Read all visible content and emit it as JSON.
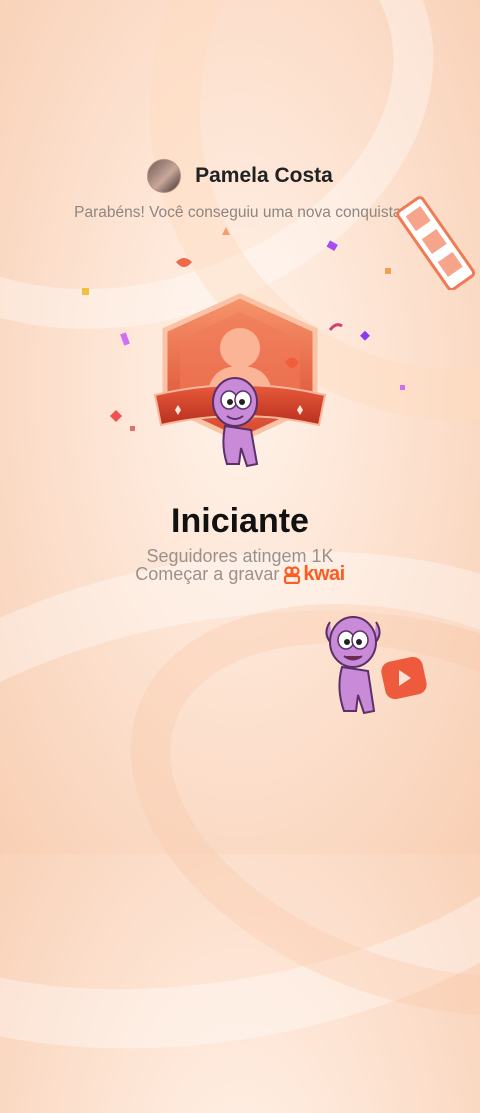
{
  "user": {
    "name": "Pamela Costa"
  },
  "message": "Parabéns! Você conseguiu uma nova conquista!",
  "achievement": {
    "title": "Iniciante",
    "requirement": "Seguidores atingem 1K",
    "cta": "Começar a gravar"
  },
  "brand": {
    "logo_text": "kwai",
    "color": "#ff5a1f"
  },
  "icons": {
    "badge": "hexagon-profile-badge-icon",
    "mascot": "pink-mascot-icon",
    "record": "play-record-icon"
  }
}
